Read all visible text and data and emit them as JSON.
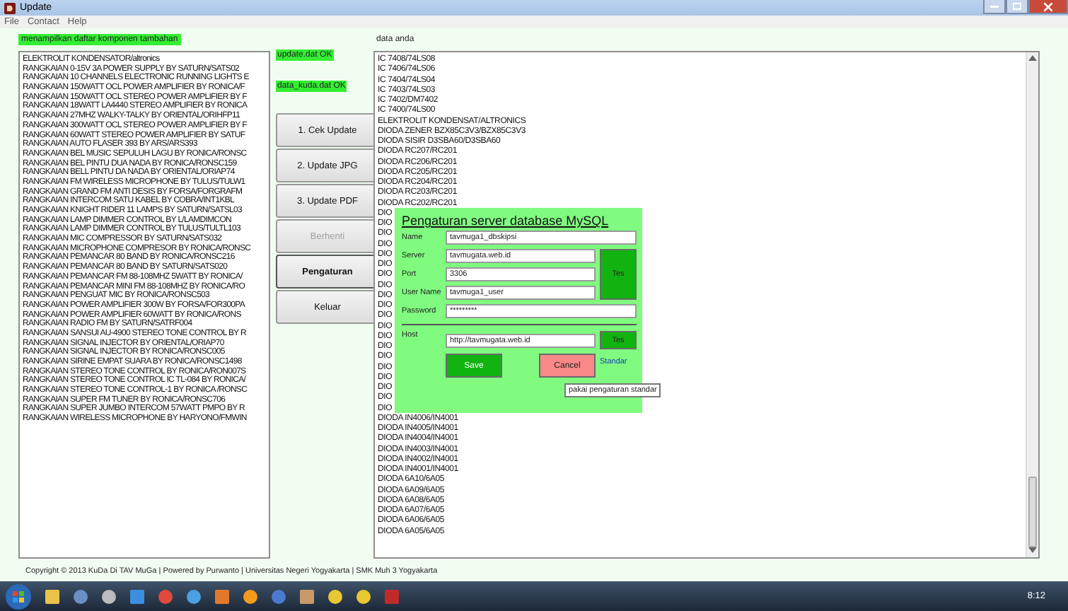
{
  "window": {
    "title": "Update"
  },
  "menu": [
    "File",
    "Contact",
    "Help"
  ],
  "component_list": {
    "caption": "menampilkan daftar komponen tambahan",
    "items": [
      "ELEKTROLIT KONDENSATOR/altronics",
      "RANGKAIAN 0-15V 3A POWER SUPPLY BY SATURN/SATS02",
      "RANGKAIAN 10 CHANNELS ELECTRONIC RUNNING LIGHTS E",
      "RANGKAIAN 150WATT OCL POWER AMPLIFIER BY RONICA/F",
      "RANGKAIAN 150WATT OCL STEREO POWER AMPLIFIER BY F",
      "RANGKAIAN 18WATT LA4440 STEREO AMPLIFIER BY RONICA",
      "RANGKAIAN 27MHZ WALKY-TALKY BY ORIENTAL/ORIHFP11",
      "RANGKAIAN 300WATT OCL STEREO POWER AMPLIFIER BY F",
      "RANGKAIAN 60WATT STEREO POWER AMPLIFIER BY SATUF",
      "RANGKAIAN AUTO FLASER 393 BY ARS/ARS393",
      "RANGKAIAN BEL MUSIC SEPULUH LAGU BY RONICA/RONSC",
      "RANGKAIAN BEL PINTU DUA NADA BY RONICA/RONSC159",
      "RANGKAIAN BELL PINTU DA NADA BY ORIENTAL/ORIAP74",
      "RANGKAIAN FM WIRELESS MICROPHONE BY TULUS/TULW1",
      "RANGKAIAN GRAND FM ANTI DESIS BY FORSA/FORGRAFM",
      "RANGKAIAN INTERCOM SATU KABEL BY COBRA/INT1KBL",
      "RANGKAIAN KNIGHT RIDER 11 LAMPS BY SATURN/SATSL03",
      "RANGKAIAN LAMP DIMMER CONTROL BY L/LAMDIMCON",
      "RANGKAIAN LAMP DIMMER CONTROL BY TULUS/TULTL103",
      "RANGKAIAN MIC COMPRESSOR BY SATURN/SATS032",
      "RANGKAIAN MICROPHONE COMPRESOR BY RONICA/RONSC",
      "RANGKAIAN PEMANCAR 80 BAND BY RONICA/RONSC216",
      "RANGKAIAN PEMANCAR 80 BAND BY SATURN/SATS020",
      "RANGKAIAN PEMANCAR FM 88-108MHZ 5WATT BY RONICA/",
      "RANGKAIAN PEMANCAR MINI FM 88-108MHZ BY RONICA/RO",
      "RANGKAIAN PENGUAT MIC BY RONICA/RONSC503",
      "RANGKAIAN POWER AMPLIFIER 300W BY FORSA/FOR300PA",
      "RANGKAIAN POWER AMPLIFIER 60WATT BY RONICA/RONS",
      "RANGKAIAN RADIO FM BY SATURN/SATRF004",
      "RANGKAIAN SANSUI AU-4900 STEREO TONE CONTROL BY R",
      "RANGKAIAN SIGNAL INJECTOR BY ORIENTAL/ORIAP70",
      "RANGKAIAN SIGNAL INJECTOR BY RONICA/RONSC005",
      "RANGKAIAN SIRINE EMPAT SUARA BY RONICA/RONSC1498",
      "RANGKAIAN STEREO TONE CONTROL BY RONICA/RON007S",
      "RANGKAIAN STEREO TONE CONTROL IC TL-084 BY RONICA/",
      "RANGKAIAN STEREO TONE CONTROL-1 BY RONICA /RONSC",
      "RANGKAIAN SUPER FM TUNER BY RONICA/RONSC706",
      "RANGKAIAN SUPER JUMBO INTERCOM 57WATT PMPO BY R",
      "RANGKAIAN WIRELESS MICROPHONE BY HARYONO/FMWIN"
    ]
  },
  "status_labels": [
    "update.dat OK",
    "data_kuda.dat OK"
  ],
  "buttons": [
    {
      "label": "1. Cek Update",
      "disabled": false,
      "focused": false
    },
    {
      "label": "2. Update JPG",
      "disabled": false,
      "focused": false
    },
    {
      "label": "3. Update PDF",
      "disabled": false,
      "focused": false
    },
    {
      "label": "Berhenti",
      "disabled": true,
      "focused": false
    },
    {
      "label": "Pengaturan",
      "disabled": false,
      "focused": true
    },
    {
      "label": "Keluar",
      "disabled": false,
      "focused": false
    }
  ],
  "data_list": {
    "caption": "data anda",
    "items": [
      "IC 7408/74LS08",
      "IC 7406/74LS06",
      "IC 7404/74LS04",
      "IC 7403/74LS03",
      "IC 7402/DM7402",
      "IC 7400/74LS00",
      "ELEKTROLIT KONDENSAT/ALTRONICS",
      "DIODA ZENER BZX85C3V3/BZX85C3V3",
      "DIODA SISIR D3SBA60/D3SBA60",
      "DIODA RC207/RC201",
      "DIODA RC206/RC201",
      "DIODA RC205/RC201",
      "DIODA RC204/RC201",
      "DIODA RC203/RC201",
      "DIODA RC202/RC201",
      "DIO",
      "DIO",
      "DIO",
      "DIO",
      "DIO",
      "DIO",
      "DIO",
      "DIO",
      "DIO",
      "DIO",
      "DIO",
      "DIO",
      "DIO",
      "DIO",
      "DIO",
      "DIO",
      "DIO",
      "DIO",
      "DIO",
      "DIO",
      "DIODA IN4006/IN4001",
      "DIODA IN4005/IN4001",
      "DIODA IN4004/IN4001",
      "DIODA IN4003/IN4001",
      "DIODA IN4002/IN4001",
      "DIODA IN4001/IN4001",
      "DIODA 6A10/6A05",
      "DIODA 6A09/6A05",
      "DIODA 6A08/6A05",
      "DIODA 6A07/6A05",
      "DIODA 6A06/6A05",
      "DIODA 6A05/6A05"
    ]
  },
  "settings_dialog": {
    "title": "Pengaturan server database MySQL",
    "fields": [
      {
        "label": "Name",
        "value": "tavmuga1_dbskipsi"
      },
      {
        "label": "Server",
        "value": "tavmugata.web.id"
      },
      {
        "label": "Port",
        "value": "3306"
      },
      {
        "label": "User Name",
        "value": "tavmuga1_user"
      },
      {
        "label": "Password",
        "value": "*********"
      }
    ],
    "host": {
      "label": "Host",
      "value": "http://tavmugata.web.id"
    },
    "test_buttons": [
      "Tes",
      "Tes"
    ],
    "save": "Save",
    "cancel": "Cancel",
    "default_link": "Standar",
    "tooltip": "pakai pengaturan standar"
  },
  "footer": "Copyright © 2013 KuDa Di TAV MuGa | Powered by Purwanto | Universitas Negeri Yogyakarta | SMK Muh 3 Yogyakarta",
  "taskbar": {
    "clock": "8:12"
  }
}
